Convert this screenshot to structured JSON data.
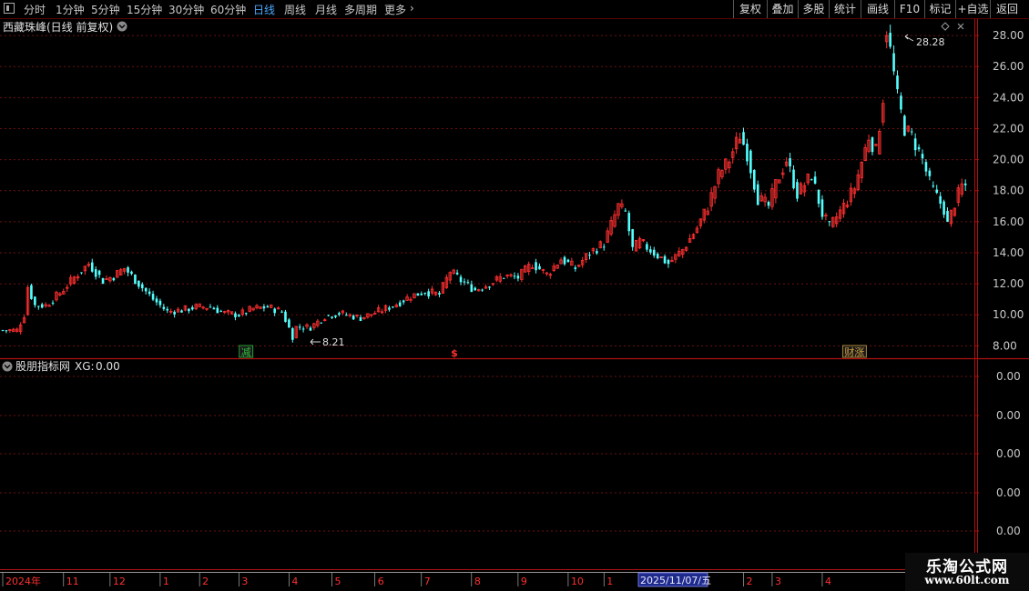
{
  "toolbar": {
    "periods": [
      {
        "label": "分时",
        "active": false
      },
      {
        "label": "1分钟",
        "active": false
      },
      {
        "label": "5分钟",
        "active": false
      },
      {
        "label": "15分钟",
        "active": false
      },
      {
        "label": "30分钟",
        "active": false
      },
      {
        "label": "60分钟",
        "active": false
      },
      {
        "label": "日线",
        "active": true
      },
      {
        "label": "周线",
        "active": false
      },
      {
        "label": "月线",
        "active": false
      },
      {
        "label": "多周期",
        "active": false
      },
      {
        "label": "更多",
        "active": false
      }
    ],
    "buttons": [
      "复权",
      "叠加",
      "多股",
      "统计",
      "画线",
      "F10",
      "标记",
      "+自选",
      "返回"
    ]
  },
  "main_panel": {
    "title": "西藏珠峰(日线 前复权)",
    "event_markers": [
      {
        "label": "减",
        "date_index": 68,
        "color": "#2fbf3f"
      },
      {
        "label": "$",
        "date_index": 126,
        "color": "#ff3030"
      },
      {
        "label": "财涨",
        "date_index": 238,
        "color": "#d0a040"
      }
    ]
  },
  "indicator_panel": {
    "title": "股朋指标网",
    "series_label": "XG:",
    "series_value": "0.00",
    "axis_ticks": [
      "0.00",
      "0.00",
      "0.00",
      "0.00",
      "0.00"
    ]
  },
  "date_axis": {
    "labels": [
      {
        "text": "2024年",
        "index": 0
      },
      {
        "text": "11",
        "index": 17
      },
      {
        "text": "12",
        "index": 30
      },
      {
        "text": "1",
        "index": 44
      },
      {
        "text": "2",
        "index": 55
      },
      {
        "text": "3",
        "index": 66
      },
      {
        "text": "4",
        "index": 80
      },
      {
        "text": "5",
        "index": 92
      },
      {
        "text": "6",
        "index": 104
      },
      {
        "text": "7",
        "index": 117
      },
      {
        "text": "8",
        "index": 131
      },
      {
        "text": "9",
        "index": 144
      },
      {
        "text": "10",
        "index": 158
      },
      {
        "text": "1",
        "index": 168
      },
      {
        "text": "1",
        "index": 195
      },
      {
        "text": "2",
        "index": 207
      },
      {
        "text": "3",
        "index": 215
      },
      {
        "text": "4",
        "index": 229
      }
    ],
    "cursor_date": "2025/11/07/五"
  },
  "colors": {
    "up": "#ff3030",
    "down": "#54ffff",
    "grid": "#6e1010",
    "frame": "#b01010",
    "axis_text": "#c8c8c8"
  },
  "watermark": {
    "title": "乐淘公式网",
    "url": "www.60lt.com"
  },
  "chart_data": {
    "type": "candlestick",
    "ylim": [
      7.2,
      29.0
    ],
    "y_ticks": [
      "28.00",
      "26.00",
      "24.00",
      "22.00",
      "20.00",
      "18.00",
      "16.00",
      "14.00",
      "12.00",
      "10.00",
      "8.00"
    ],
    "max_label": "28.28",
    "min_label": "8.21",
    "close_anchors": [
      [
        0,
        9.0
      ],
      [
        4,
        9.0
      ],
      [
        6,
        10.0
      ],
      [
        7,
        11.8
      ],
      [
        9,
        10.6
      ],
      [
        12,
        10.6
      ],
      [
        16,
        11.4
      ],
      [
        20,
        12.4
      ],
      [
        24,
        13.3
      ],
      [
        28,
        12.2
      ],
      [
        31,
        12.5
      ],
      [
        34,
        13.0
      ],
      [
        38,
        12.0
      ],
      [
        42,
        11.0
      ],
      [
        46,
        10.2
      ],
      [
        50,
        10.3
      ],
      [
        54,
        10.5
      ],
      [
        58,
        10.5
      ],
      [
        62,
        10.1
      ],
      [
        66,
        10.0
      ],
      [
        70,
        10.4
      ],
      [
        74,
        10.5
      ],
      [
        78,
        10.2
      ],
      [
        81,
        8.6
      ],
      [
        82,
        9.2
      ],
      [
        86,
        9.2
      ],
      [
        90,
        9.9
      ],
      [
        94,
        10.1
      ],
      [
        100,
        9.8
      ],
      [
        106,
        10.3
      ],
      [
        110,
        10.7
      ],
      [
        114,
        11.2
      ],
      [
        118,
        11.5
      ],
      [
        122,
        11.3
      ],
      [
        125,
        12.8
      ],
      [
        128,
        12.2
      ],
      [
        132,
        11.6
      ],
      [
        136,
        12.0
      ],
      [
        140,
        12.5
      ],
      [
        144,
        12.4
      ],
      [
        148,
        13.3
      ],
      [
        152,
        12.6
      ],
      [
        156,
        13.6
      ],
      [
        160,
        13.0
      ],
      [
        164,
        14.0
      ],
      [
        168,
        14.6
      ],
      [
        172,
        17.0
      ],
      [
        174,
        16.6
      ],
      [
        176,
        14.2
      ],
      [
        178,
        14.7
      ],
      [
        182,
        14.0
      ],
      [
        186,
        13.3
      ],
      [
        190,
        14.2
      ],
      [
        194,
        15.6
      ],
      [
        197,
        17.0
      ],
      [
        200,
        19.0
      ],
      [
        203,
        20.0
      ],
      [
        206,
        21.6
      ],
      [
        208,
        20.4
      ],
      [
        211,
        17.5
      ],
      [
        214,
        17.0
      ],
      [
        216,
        18.4
      ],
      [
        219,
        20.0
      ],
      [
        222,
        17.8
      ],
      [
        226,
        19.0
      ],
      [
        229,
        16.5
      ],
      [
        231,
        15.6
      ],
      [
        235,
        17.0
      ],
      [
        238,
        18.2
      ],
      [
        242,
        21.5
      ],
      [
        244,
        20.5
      ],
      [
        246,
        24.0
      ],
      [
        247,
        28.0
      ],
      [
        248,
        27.0
      ],
      [
        250,
        24.0
      ],
      [
        252,
        22.0
      ],
      [
        254,
        21.5
      ],
      [
        257,
        20.0
      ],
      [
        259,
        18.5
      ],
      [
        261,
        17.6
      ],
      [
        263,
        16.8
      ],
      [
        264,
        15.8
      ],
      [
        266,
        17.2
      ],
      [
        268,
        18.3
      ]
    ]
  }
}
